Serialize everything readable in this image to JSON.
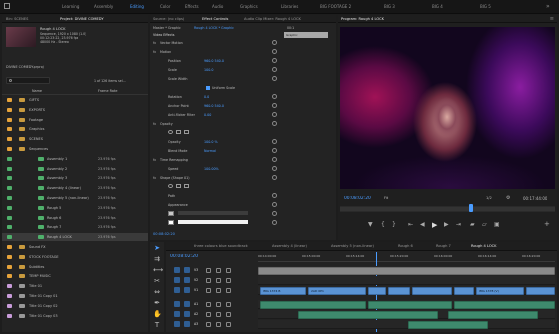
{
  "workspaces": [
    {
      "label": "Learning",
      "active": false
    },
    {
      "label": "Assembly",
      "active": false
    },
    {
      "label": "Editing",
      "active": true
    },
    {
      "label": "Color",
      "active": false
    },
    {
      "label": "Effects",
      "active": false
    },
    {
      "label": "Audio",
      "active": false
    },
    {
      "label": "Graphics",
      "active": false
    },
    {
      "label": "Libraries",
      "active": false
    },
    {
      "label": "BIG FOOTAGE 2",
      "active": false
    },
    {
      "label": "BIG 3",
      "active": false
    },
    {
      "label": "BIG 4",
      "active": false
    },
    {
      "label": "BIG 5",
      "active": false
    }
  ],
  "project": {
    "tabs": [
      "Bin: SCENES",
      "Project: DIVINE COMEDY"
    ],
    "clip_name": "Rough 4 LOCK",
    "clip_info": [
      "Sequence, 1920 x 1080 (1.0)",
      "00:12:23:22, 23.976 fps",
      "48000 Hz - Stereo"
    ],
    "project_file": "DIVINE COMEDY.prproj",
    "items_count": "1 of 126 items sel...",
    "col_name": "Name",
    "col_rate": "Frame Rate",
    "items": [
      {
        "name": "GIFTS",
        "rate": "",
        "color": "#e6a33a",
        "type": "bin"
      },
      {
        "name": "EXPORTS",
        "rate": "",
        "color": "#e6a33a",
        "type": "bin"
      },
      {
        "name": "Footage",
        "rate": "",
        "color": "#e6a33a",
        "type": "bin"
      },
      {
        "name": "Graphics",
        "rate": "",
        "color": "#e6a33a",
        "type": "bin"
      },
      {
        "name": "SCENES",
        "rate": "",
        "color": "#e6a33a",
        "type": "bin"
      },
      {
        "name": "Sequences",
        "rate": "",
        "color": "#e6a33a",
        "type": "bin"
      },
      {
        "name": "Assembly 1",
        "rate": "23.976 fps",
        "color": "#4fb06b",
        "type": "seq"
      },
      {
        "name": "Assembly 2",
        "rate": "23.976 fps",
        "color": "#4fb06b",
        "type": "seq"
      },
      {
        "name": "Assembly 3",
        "rate": "23.976 fps",
        "color": "#4fb06b",
        "type": "seq"
      },
      {
        "name": "Assembly 4 (linear)",
        "rate": "23.976 fps",
        "color": "#4fb06b",
        "type": "seq"
      },
      {
        "name": "Assembly 5 (non-linear)",
        "rate": "23.976 fps",
        "color": "#4fb06b",
        "type": "seq"
      },
      {
        "name": "Rough 5",
        "rate": "23.976 fps",
        "color": "#4fb06b",
        "type": "seq"
      },
      {
        "name": "Rough 6",
        "rate": "23.976 fps",
        "color": "#4fb06b",
        "type": "seq"
      },
      {
        "name": "Rough 7",
        "rate": "23.976 fps",
        "color": "#4fb06b",
        "type": "seq"
      },
      {
        "name": "Rough 4 LOCK",
        "rate": "23.976 fps",
        "color": "#4fb06b",
        "type": "seq",
        "selected": true
      },
      {
        "name": "Sound FX",
        "rate": "",
        "color": "#e6a33a",
        "type": "bin"
      },
      {
        "name": "STOCK FOOTAGE",
        "rate": "",
        "color": "#e6a33a",
        "type": "bin"
      },
      {
        "name": "Subtitles",
        "rate": "",
        "color": "#e6a33a",
        "type": "bin"
      },
      {
        "name": "TEMP MUSIC",
        "rate": "",
        "color": "#e6a33a",
        "type": "bin"
      },
      {
        "name": "Title 01",
        "rate": "",
        "color": "#c79bd8",
        "type": "file"
      },
      {
        "name": "Title 01 Copy 01",
        "rate": "",
        "color": "#c79bd8",
        "type": "file"
      },
      {
        "name": "Title 01 Copy 02",
        "rate": "",
        "color": "#c79bd8",
        "type": "file"
      },
      {
        "name": "Title 01 Copy 03",
        "rate": "",
        "color": "#c79bd8",
        "type": "file"
      }
    ]
  },
  "effect_controls": {
    "tabs": [
      "Source: (no clips)",
      "Effect Controls",
      "Audio Clip Mixer: Rough 4 LOCK"
    ],
    "master": "Master * Graphic",
    "sequence": "Rough 4 LOCK * Graphic",
    "timecode_left": "00:1",
    "clip_label": "Graphic",
    "section": "Video Effects",
    "rows": [
      {
        "label": "Vector Motion",
        "value": "",
        "indent": 1,
        "fx": true
      },
      {
        "label": "Motion",
        "value": "",
        "indent": 1,
        "fx": true
      },
      {
        "label": "Position",
        "value": "960.0     540.0",
        "indent": 3
      },
      {
        "label": "Scale",
        "value": "100.0",
        "indent": 3
      },
      {
        "label": "Scale Width",
        "value": "",
        "indent": 3
      },
      {
        "label": "",
        "value": "Uniform Scale",
        "indent": 6,
        "check": true
      },
      {
        "label": "Rotation",
        "value": "0.0",
        "indent": 3
      },
      {
        "label": "Anchor Point",
        "value": "960.0     540.0",
        "indent": 3
      },
      {
        "label": "Anti-flicker Filter",
        "value": "0.00",
        "indent": 3
      },
      {
        "label": "Opacity",
        "value": "",
        "indent": 1,
        "fx": true
      },
      {
        "label": "",
        "value": "",
        "indent": 3,
        "masks": true
      },
      {
        "label": "Opacity",
        "value": "100.0 %",
        "indent": 3
      },
      {
        "label": "Blend Mode",
        "value": "Normal",
        "indent": 3
      },
      {
        "label": "Time Remapping",
        "value": "",
        "indent": 1,
        "fx": true
      },
      {
        "label": "Speed",
        "value": "100.00%",
        "indent": 3
      },
      {
        "label": "Shape (Shape 01)",
        "value": "",
        "indent": 1,
        "fx": true
      },
      {
        "label": "",
        "value": "",
        "indent": 3,
        "masks": true
      },
      {
        "label": "Path",
        "value": "",
        "indent": 3
      },
      {
        "label": "Appearance",
        "value": "",
        "indent": 3
      },
      {
        "label": "Fill",
        "value": "",
        "indent": 6,
        "fill": true
      },
      {
        "label": "",
        "value": "",
        "indent": 6,
        "stroke": true
      }
    ],
    "timecode": "00:08:02:20"
  },
  "program": {
    "title": "Program: Rough 4 LOCK",
    "timecode": "00:08:02:20",
    "fit": "Fit",
    "quality": "1/2",
    "duration": "00:17:44:00",
    "accent": "#4a9cff"
  },
  "timeline": {
    "tabs": [
      "three colours blue soundtrack",
      "Assembly 4 (linear)",
      "Assembly 5 (non-linear)",
      "Rough 6",
      "Rough 7",
      "Rough 4 LOCK"
    ],
    "timecode": "00:08:02:20",
    "ruler": [
      "00:14:00:00",
      "00:15:00:00",
      "00:15:14:00",
      "00:15:20:00",
      "00:16:00:00",
      "00:16:14:00",
      "00:16:20:00"
    ],
    "tracks": [
      "V3",
      "V2",
      "V1",
      "A1",
      "A2",
      "A3"
    ],
    "clip_labels": [
      "IMG 1374 B",
      "2AD 0P1",
      "IMG 1378 (V)"
    ]
  }
}
